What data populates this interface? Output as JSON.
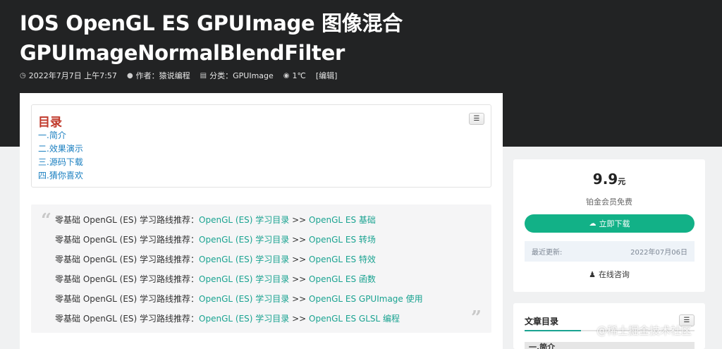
{
  "header": {
    "title_line1": "IOS OpenGL ES GPUImage 图像混合",
    "title_line2": "GPUImageNormalBlendFilter",
    "meta": {
      "date_icon": "clock-icon",
      "date": "2022年7月7日 上午7:57",
      "author_icon": "user-icon",
      "author": "作者：猿说编程",
      "category_icon": "folder-icon",
      "category": "分类：GPUImage",
      "views_icon": "eye-icon",
      "views": "1℃",
      "edit": "[编辑]"
    }
  },
  "toc": {
    "title": "目录",
    "toggle_icon": "list-icon",
    "items": [
      "一.简介",
      "二.效果演示",
      "三.源码下载",
      "四.猜你喜欢"
    ]
  },
  "quote": {
    "open": "“",
    "close": "”",
    "lines": [
      {
        "prefix": "零基础 OpenGL (ES) 学习路线推荐：",
        "link1": "OpenGL (ES) 学习目录",
        "sep": " >> ",
        "link2": "OpenGL ES 基础"
      },
      {
        "prefix": "零基础 OpenGL (ES) 学习路线推荐：",
        "link1": "OpenGL (ES) 学习目录",
        "sep": " >> ",
        "link2": "OpenGL ES 转场"
      },
      {
        "prefix": "零基础 OpenGL (ES) 学习路线推荐：",
        "link1": "OpenGL (ES) 学习目录",
        "sep": " >> ",
        "link2": "OpenGL ES 特效"
      },
      {
        "prefix": "零基础 OpenGL (ES) 学习路线推荐：",
        "link1": "OpenGL (ES) 学习目录",
        "sep": " >> ",
        "link2": "OpenGL ES 函数"
      },
      {
        "prefix": "零基础 OpenGL (ES) 学习路线推荐：",
        "link1": "OpenGL (ES) 学习目录",
        "sep": " >> ",
        "link2": "OpenGL ES GPUImage 使用"
      },
      {
        "prefix": "零基础 OpenGL (ES) 学习路线推荐：",
        "link1": "OpenGL (ES) 学习目录",
        "sep": " >> ",
        "link2": "OpenGL ES GLSL 编程"
      }
    ]
  },
  "download_widget": {
    "price": "9.9",
    "unit": "元",
    "membership": "铂金会员免费",
    "download_icon": "cloud-download-icon",
    "download_label": "立即下载",
    "updated_label": "最近更新:",
    "updated_value": "2022年07月06日",
    "consult_icon": "qq-icon",
    "consult_label": "在线咨询"
  },
  "side_toc": {
    "title": "文章目录",
    "toggle_icon": "list-icon",
    "first_item": "一.简介"
  },
  "watermark": "@稀土掘金技术社区",
  "colors": {
    "header_bg": "#222324",
    "accent_green": "#12b187",
    "link_teal": "#1aa391",
    "toc_title_red": "#c0392b",
    "toc_link_blue": "#1a7fc0"
  }
}
